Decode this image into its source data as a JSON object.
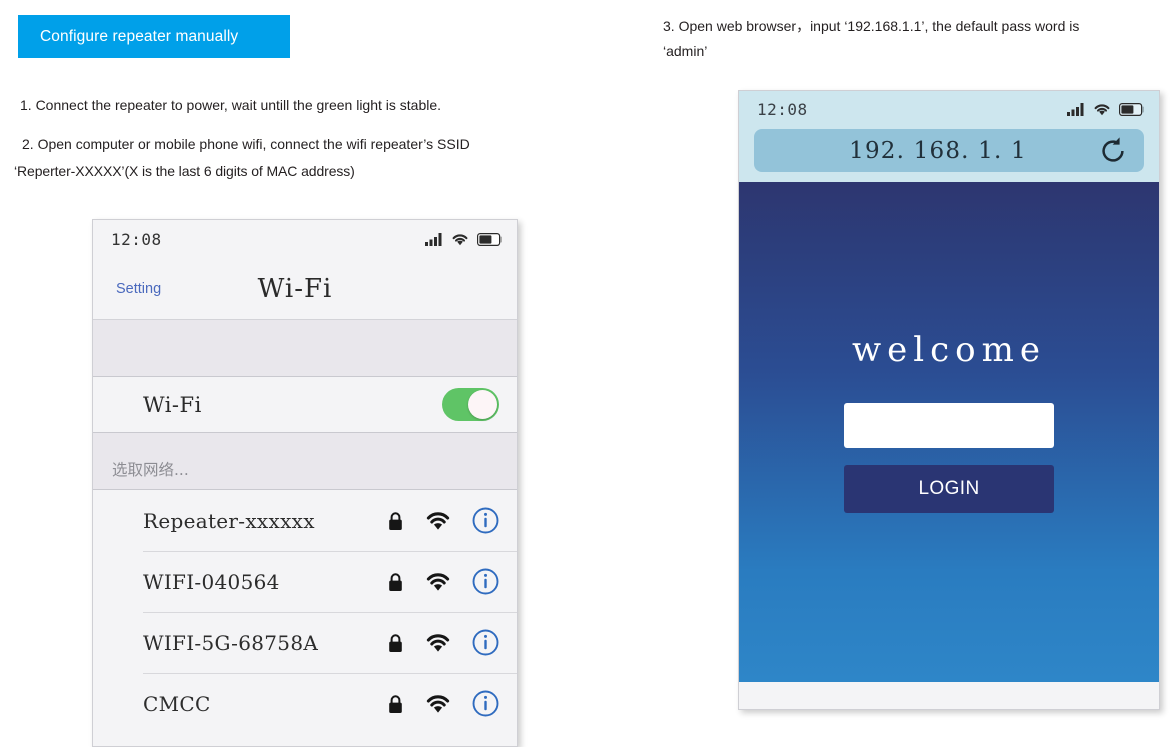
{
  "instructions": {
    "badge_label": "Configure repeater manually",
    "step1": "1. Connect the repeater to power, wait untill the green light is stable.",
    "step2": "2. Open computer or mobile phone wifi, connect the wifi repeater’s SSID",
    "step2_cont": "‘Reperter-XXXXX’(X is the last 6 digits of MAC address)",
    "step3": "3. Open web browser，input ‘192.168.1.1’, the default pass word is",
    "step3_cont": "‘admin’"
  },
  "wifi_phone": {
    "status": {
      "time": "12:08",
      "signal_icon": "cellular-signal-icon",
      "wifi_icon": "wifi-icon",
      "battery_icon": "battery-icon"
    },
    "navbar": {
      "back_label": "Setting",
      "title": "Wi-Fi"
    },
    "toggle": {
      "label": "Wi-Fi",
      "state": "on"
    },
    "section_header": "选取网络...",
    "networks": [
      {
        "ssid": "Repeater-xxxxxx",
        "lock_icon": "lock-icon",
        "signal_icon": "wifi-icon",
        "info_icon": "info-circle-icon"
      },
      {
        "ssid": "WIFI-040564",
        "lock_icon": "lock-icon",
        "signal_icon": "wifi-icon",
        "info_icon": "info-circle-icon"
      },
      {
        "ssid": "WIFI-5G-68758A",
        "lock_icon": "lock-icon",
        "signal_icon": "wifi-icon",
        "info_icon": "info-circle-icon"
      },
      {
        "ssid": "CMCC",
        "lock_icon": "lock-icon",
        "signal_icon": "wifi-icon",
        "info_icon": "info-circle-icon"
      }
    ]
  },
  "browser_phone": {
    "status": {
      "time": "12:08",
      "signal_icon": "cellular-signal-icon",
      "wifi_icon": "wifi-icon",
      "battery_icon": "battery-icon"
    },
    "urlbar": {
      "value": "192. 168. 1. 1",
      "placeholder": "192.168.1.1",
      "refresh_icon": "refresh-icon"
    },
    "login_page": {
      "heading": "welcome",
      "password_value": "",
      "password_placeholder": "",
      "login_label": "LOGIN"
    }
  },
  "colors": {
    "badge_blue": "#00a0e9",
    "link_blue": "#4a69bd",
    "toggle_green": "#5fc466",
    "info_blue": "#2f6bbf",
    "browser_chrome": "#cde6ee",
    "urlbar_fill": "#93c3d9",
    "login_gradient_top": "#2d3670",
    "login_gradient_bottom": "#2e86c8",
    "login_button": "#2a3573"
  }
}
